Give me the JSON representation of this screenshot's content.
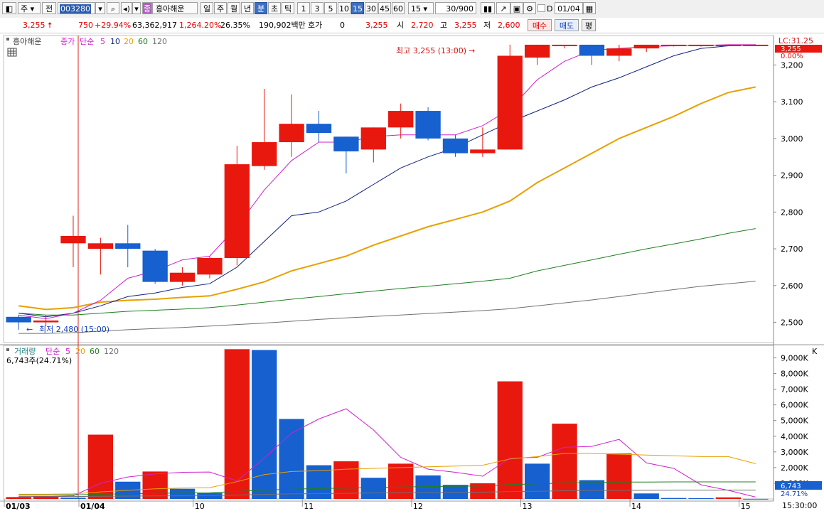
{
  "toolbar": {
    "type_sel": "주",
    "prev_label": "전",
    "code": "003280",
    "stock_name": "흥아해운",
    "stock_icon": "종",
    "periods": [
      "일",
      "주",
      "월",
      "년",
      "분",
      "초",
      "틱"
    ],
    "period_active": "분",
    "intervals": [
      "1",
      "3",
      "5",
      "10",
      "15",
      "30",
      "45",
      "60"
    ],
    "interval_active": "15",
    "interval_select": "15",
    "count": "30/900",
    "checkbox_label": "D",
    "date": "01/04"
  },
  "quote": {
    "price": "3,255",
    "change": "750",
    "change_pct": "+29.94%",
    "volume": "63,362,917",
    "vol_pct": "1,264.20%",
    "turnover_pct": "26.35%",
    "amount": "190,902백만",
    "hoga_label": "호가",
    "hoga_value": "0",
    "hoga_price": "3,255",
    "open_label": "시",
    "open": "2,720",
    "high_label": "고",
    "high": "3,255",
    "low_label": "저",
    "low": "2,600",
    "buy_label": "매수",
    "sell_label": "매도",
    "eval_label": "평"
  },
  "price_panel": {
    "legend_name": "흥아해운",
    "legend_close": "종가",
    "legend_type": "단순",
    "ma_periods": [
      "5",
      "10",
      "20",
      "60",
      "120"
    ],
    "lc_label": "LC:31.25",
    "last_price_tag": "3,255",
    "pct_tag": "0.00%",
    "high_annotation": "최고 3,255 (13:00)",
    "low_annotation": "최저 2,480 (15:00)"
  },
  "volume_panel": {
    "legend_name": "거래량",
    "legend_type": "단순",
    "ma_periods": [
      "5",
      "20",
      "60",
      "120"
    ],
    "current": "6,743주(24.71%)",
    "last_tag": "6,743",
    "last_pct": "24.71%"
  },
  "x_axis": {
    "labels": [
      "01/03",
      "01/04",
      "10",
      "11",
      "12",
      "13",
      "14",
      "15"
    ],
    "time_end": "15:30:00"
  },
  "colors": {
    "up": "#e8180f",
    "down": "#1660d0",
    "ma5": "#d020d0",
    "ma10": "#102080",
    "ma20": "#e8a000",
    "ma60": "#208020",
    "ma120": "#707070"
  },
  "chart_data": [
    {
      "type": "candlestick",
      "title": "흥아해운",
      "ylim": [
        2445,
        3280
      ],
      "yticks": [
        2500,
        2600,
        2700,
        2800,
        2900,
        3000,
        3100,
        3200
      ],
      "x": [
        "01/03 15:00",
        "01/03 15:30",
        "01/04 09:15",
        "09:30",
        "09:45",
        "10:00",
        "10:15",
        "10:30",
        "10:45",
        "11:00",
        "11:15",
        "11:30",
        "11:45",
        "12:00",
        "12:15",
        "12:30",
        "12:45",
        "13:00",
        "13:15",
        "13:30",
        "13:45",
        "14:00",
        "14:15",
        "14:30",
        "14:45",
        "15:00",
        "15:15",
        "15:30"
      ],
      "ohlc": [
        [
          2515,
          2520,
          2480,
          2500
        ],
        [
          2500,
          2520,
          2490,
          2505
        ],
        [
          2715,
          2790,
          2650,
          2735
        ],
        [
          2700,
          2730,
          2630,
          2715
        ],
        [
          2715,
          2765,
          2650,
          2700
        ],
        [
          2695,
          2700,
          2605,
          2610
        ],
        [
          2610,
          2650,
          2600,
          2635
        ],
        [
          2630,
          2680,
          2620,
          2675
        ],
        [
          2675,
          2980,
          2655,
          2930
        ],
        [
          2925,
          3135,
          2915,
          2990
        ],
        [
          2990,
          3120,
          2950,
          3040
        ],
        [
          3040,
          3075,
          2990,
          3015
        ],
        [
          3005,
          3005,
          2905,
          2965
        ],
        [
          2970,
          3030,
          2935,
          3030
        ],
        [
          3030,
          3095,
          3000,
          3075
        ],
        [
          3075,
          3085,
          2995,
          3000
        ],
        [
          3000,
          3010,
          2950,
          2960
        ],
        [
          2960,
          3030,
          2950,
          2970
        ],
        [
          2970,
          3255,
          2970,
          3225
        ],
        [
          3220,
          3255,
          3200,
          3255
        ],
        [
          3255,
          3255,
          3245,
          3255
        ],
        [
          3255,
          3255,
          3200,
          3225
        ],
        [
          3225,
          3255,
          3210,
          3245
        ],
        [
          3245,
          3255,
          3235,
          3255
        ],
        [
          3255,
          3255,
          3250,
          3255
        ],
        [
          3255,
          3255,
          3250,
          3255
        ],
        [
          3255,
          3255,
          3252,
          3255
        ],
        [
          3255,
          3255,
          3254,
          3255
        ]
      ],
      "series": [
        {
          "name": "5",
          "values": [
            2520,
            2510,
            2525,
            2560,
            2620,
            2640,
            2670,
            2680,
            2760,
            2860,
            2940,
            2990,
            2990,
            3005,
            3010,
            3010,
            3010,
            3035,
            3080,
            3160,
            3210,
            3240,
            3245,
            3250,
            3252,
            3253,
            3255,
            3255
          ]
        },
        {
          "name": "10",
          "values": [
            2525,
            2515,
            2525,
            2545,
            2570,
            2580,
            2595,
            2605,
            2650,
            2720,
            2790,
            2800,
            2830,
            2875,
            2920,
            2950,
            2975,
            3010,
            3045,
            3075,
            3105,
            3140,
            3165,
            3195,
            3225,
            3245,
            3252,
            3255
          ]
        },
        {
          "name": "20",
          "values": [
            2545,
            2535,
            2540,
            2555,
            2560,
            2563,
            2568,
            2572,
            2590,
            2610,
            2640,
            2660,
            2680,
            2710,
            2735,
            2760,
            2780,
            2800,
            2830,
            2880,
            2920,
            2960,
            3000,
            3030,
            3060,
            3095,
            3125,
            3140
          ]
        },
        {
          "name": "60",
          "values": [
            2525,
            2520,
            2520,
            2525,
            2530,
            2533,
            2536,
            2540,
            2547,
            2555,
            2563,
            2570,
            2578,
            2585,
            2592,
            2598,
            2605,
            2612,
            2620,
            2640,
            2655,
            2670,
            2685,
            2700,
            2713,
            2727,
            2742,
            2755
          ]
        },
        {
          "name": "120",
          "values": [
            2470,
            2470,
            2472,
            2476,
            2480,
            2483,
            2486,
            2490,
            2494,
            2498,
            2503,
            2508,
            2512,
            2516,
            2520,
            2524,
            2528,
            2532,
            2537,
            2545,
            2553,
            2561,
            2570,
            2580,
            2589,
            2598,
            2605,
            2612
          ]
        }
      ]
    },
    {
      "type": "bar",
      "title": "거래량",
      "ylim": [
        0,
        9700000
      ],
      "yticks": [
        1000000,
        2000000,
        3000000,
        4000000,
        5000000,
        6000000,
        7000000,
        8000000,
        9000000
      ],
      "ytick_labels": [
        "1,000K",
        "2,000K",
        "3,000K",
        "4,000K",
        "5,000K",
        "6,000K",
        "7,000K",
        "8,000K",
        "9,000K"
      ],
      "values": [
        120000,
        180000,
        80000,
        4100000,
        1100000,
        1750000,
        650000,
        380000,
        9550000,
        9500000,
        5100000,
        2150000,
        2400000,
        1350000,
        2250000,
        1500000,
        900000,
        1000000,
        7500000,
        2250000,
        4800000,
        1200000,
        2900000,
        350000,
        60000,
        50000,
        100000,
        6743
      ],
      "directions": [
        "up",
        "up",
        "down",
        "up",
        "down",
        "up",
        "down",
        "down",
        "up",
        "down",
        "down",
        "down",
        "up",
        "down",
        "up",
        "down",
        "down",
        "up",
        "up",
        "down",
        "up",
        "down",
        "up",
        "down",
        "down",
        "down",
        "up",
        "down"
      ],
      "series": [
        {
          "name": "5",
          "values": [
            150000,
            150000,
            200000,
            1000000,
            1400000,
            1600000,
            1700000,
            1720000,
            1150000,
            2600000,
            4200000,
            5100000,
            5750000,
            4400000,
            2650000,
            1900000,
            1700000,
            1450000,
            2600000,
            2650000,
            3300000,
            3350000,
            3800000,
            2300000,
            1950000,
            900000,
            550000,
            120000
          ]
        },
        {
          "name": "20",
          "values": [
            300000,
            300000,
            320000,
            450000,
            550000,
            650000,
            700000,
            720000,
            1100000,
            1550000,
            1750000,
            1800000,
            1900000,
            1950000,
            2000000,
            2050000,
            2100000,
            2150000,
            2550000,
            2700000,
            2900000,
            2900000,
            2850000,
            2800000,
            2750000,
            2700000,
            2700000,
            2250000
          ]
        },
        {
          "name": "60",
          "values": [
            250000,
            250000,
            260000,
            300000,
            330000,
            360000,
            380000,
            390000,
            480000,
            560000,
            620000,
            660000,
            700000,
            730000,
            760000,
            790000,
            810000,
            830000,
            920000,
            960000,
            1020000,
            1040000,
            1070000,
            1080000,
            1090000,
            1090000,
            1090000,
            1090000
          ]
        },
        {
          "name": "120",
          "values": [
            150000,
            150000,
            155000,
            170000,
            180000,
            190000,
            200000,
            205000,
            250000,
            290000,
            320000,
            340000,
            360000,
            380000,
            395000,
            410000,
            420000,
            430000,
            470000,
            490000,
            520000,
            530000,
            550000,
            555000,
            560000,
            562000,
            565000,
            565000
          ]
        }
      ]
    }
  ]
}
